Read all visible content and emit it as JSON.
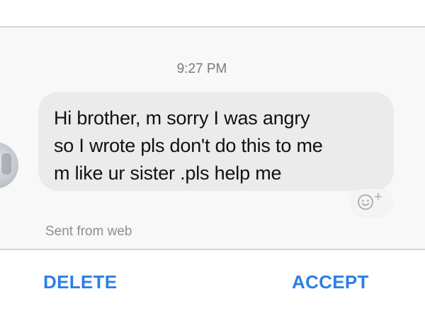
{
  "header": {
    "title": ""
  },
  "conversation": {
    "timestamp": "9:27 PM",
    "message": "Hi brother, m sorry I was angry\nso I wrote pls don't do this to me\nm like ur sister .pls help me",
    "react_plus": "+",
    "sent_from": "Sent from web",
    "avatar": "contact-avatar"
  },
  "actions": {
    "delete_label": "DELETE",
    "accept_label": "ACCEPT"
  },
  "colors": {
    "accent": "#2d7fe3",
    "bubble": "#ebebeb",
    "background": "#f8f8f8"
  },
  "icons": {
    "react": "smiley-add-icon"
  }
}
